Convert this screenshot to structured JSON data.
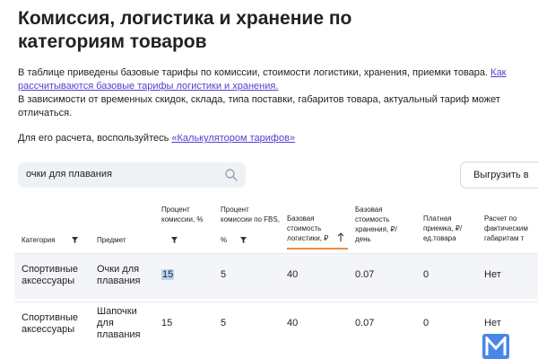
{
  "page": {
    "title": "Комиссия, логистика и хранение по категориям товаров",
    "intro_text": "В таблице приведены базовые тарифы по комиссии, стоимости логистики, хранения, приемки товара.",
    "intro_link": "Как рассчитываются базовые тарифы логистики и хранения.",
    "intro_text2": "В зависимости от временных скидок, склада, типа поставки, габаритов товара, актуальный тариф может отличаться.",
    "calc_prefix": "Для его расчета, воспользуйтесь ",
    "calc_link": "«Калькулятором тарифов»"
  },
  "search": {
    "value": "очки для плавания"
  },
  "toolbar": {
    "export_label": "Выгрузить в"
  },
  "table": {
    "headers": {
      "category": "Категория",
      "subject": "Предмет",
      "commission_l1": "Процент",
      "commission_l2": "комиссии, %",
      "fbs_l1": "Процент",
      "fbs_l2": "комиссии по FBS,",
      "fbs_l3": "%",
      "logistics_l1": "Базовая",
      "logistics_l2": "стоимость",
      "logistics_l3": "логистики, ₽",
      "storage_l1": "Базовая",
      "storage_l2": "стоимость",
      "storage_l3": "хранения, ₽/",
      "storage_l4": "день",
      "acceptance_l1": "Платная",
      "acceptance_l2": "приемка, ₽/",
      "acceptance_l3": "ед.товара",
      "actual_l1": "Расчет по",
      "actual_l2": "фактическим",
      "actual_l3": "габаритам т"
    },
    "rows": [
      {
        "category_l1": "Спортивные",
        "category_l2": "аксессуары",
        "subject_l1": "Очки для",
        "subject_l2": "плавания",
        "subject_l3": "",
        "commission": "15",
        "fbs": "5",
        "logistics": "40",
        "storage": "0.07",
        "acceptance": "0",
        "actual": "Нет"
      },
      {
        "category_l1": "Спортивные",
        "category_l2": "аксессуары",
        "subject_l1": "Шапочки",
        "subject_l2": "для",
        "subject_l3": "плавания",
        "commission": "15",
        "fbs": "5",
        "logistics": "40",
        "storage": "0.07",
        "acceptance": "0",
        "actual": "Нет"
      }
    ]
  },
  "logo": {
    "letter": "M"
  },
  "colors": {
    "link": "#5b3ccc",
    "accent_underline": "#f08a3c",
    "logo_bg": "#4a86e8",
    "search_bg": "#eef1f6"
  }
}
